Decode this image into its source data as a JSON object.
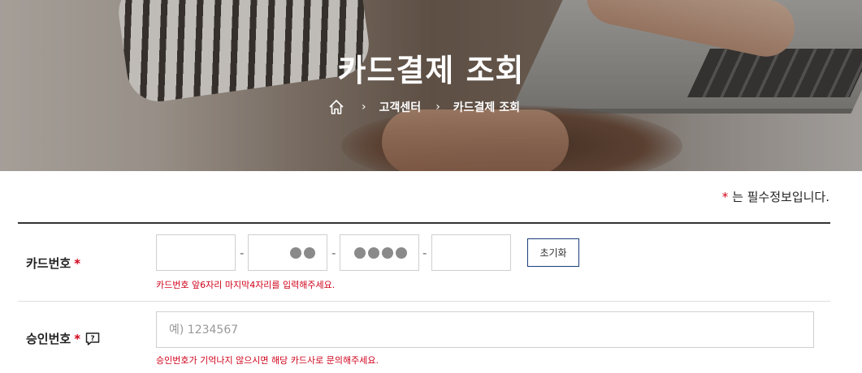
{
  "header": {
    "title": "카드결제 조회",
    "breadcrumb": [
      {
        "icon": "home-icon"
      },
      {
        "label": "고객센터"
      },
      {
        "label": "카드결제 조회"
      }
    ],
    "separator": "›"
  },
  "required_note": {
    "star": "*",
    "text": "는 필수정보입니다."
  },
  "card_number": {
    "label": "카드번호",
    "required_mark": "*",
    "segments": [
      {
        "value": "",
        "masked_dots": 0
      },
      {
        "value": "",
        "masked_dots": 2
      },
      {
        "value": "",
        "masked_dots": 4
      },
      {
        "value": "",
        "masked_dots": 0
      }
    ],
    "separator": "-",
    "reset_label": "초기화",
    "hint": "카드번호 앞6자리 마지막4자리를 입력해주세요."
  },
  "approval_number": {
    "label": "승인번호",
    "required_mark": "*",
    "help_icon": "help-question-icon",
    "placeholder": "예) 1234567",
    "value": "",
    "hint": "승인번호가 기억나지 않으시면 해당 카드사로 문의해주세요."
  },
  "colors": {
    "required": "#d0021b",
    "button_border": "#1b3d7a",
    "rule": "#333333"
  }
}
